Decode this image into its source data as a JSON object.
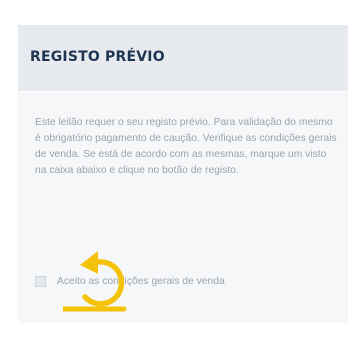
{
  "panel": {
    "title": "REGISTO PRÉVIO",
    "description": "Este leilão requer o seu registo prévio. Para validação do mesmo é obrigatório pagamento de caução. Verifique as condições gerais de venda. Se está de acordo com as mesmas, marque um visto na caixa abaixo e clique no botão de registo.",
    "consent": {
      "label": "Aceito as condições gerais de venda",
      "checked": false
    }
  },
  "colors": {
    "header_bg": "#e7ebef",
    "title": "#1f3552",
    "body_text": "#9aa3ad",
    "overlay_icon": "#f5c20a"
  },
  "overlay": {
    "icon": "undo-arrow-icon"
  }
}
